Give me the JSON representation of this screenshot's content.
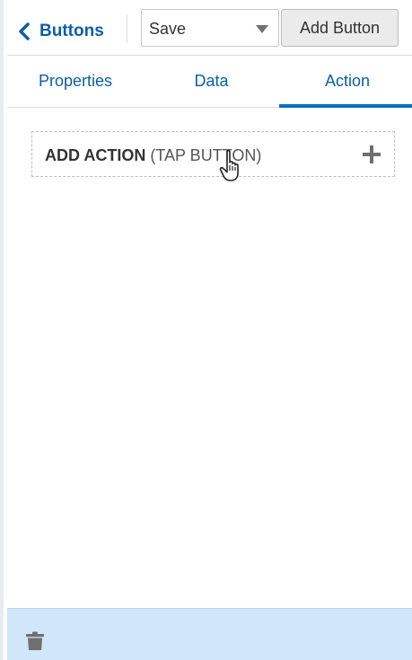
{
  "header": {
    "back_label": "Buttons",
    "select_value": "Save",
    "add_button_label": "Add Button"
  },
  "tabs": [
    {
      "label": "Properties",
      "active": false
    },
    {
      "label": "Data",
      "active": false
    },
    {
      "label": "Action",
      "active": true
    }
  ],
  "action": {
    "title_bold": "ADD ACTION",
    "title_sub": "(TAP BUTTON)"
  },
  "icons": {
    "back": "chevron-left-icon",
    "caret": "chevron-down-icon",
    "add": "plus-icon",
    "cursor": "hand-pointer-icon",
    "delete": "trash-icon"
  },
  "colors": {
    "accent": "#0b5ea8",
    "tab_indicator": "#0b6ec5",
    "footer_bg": "#d1e6f8"
  }
}
